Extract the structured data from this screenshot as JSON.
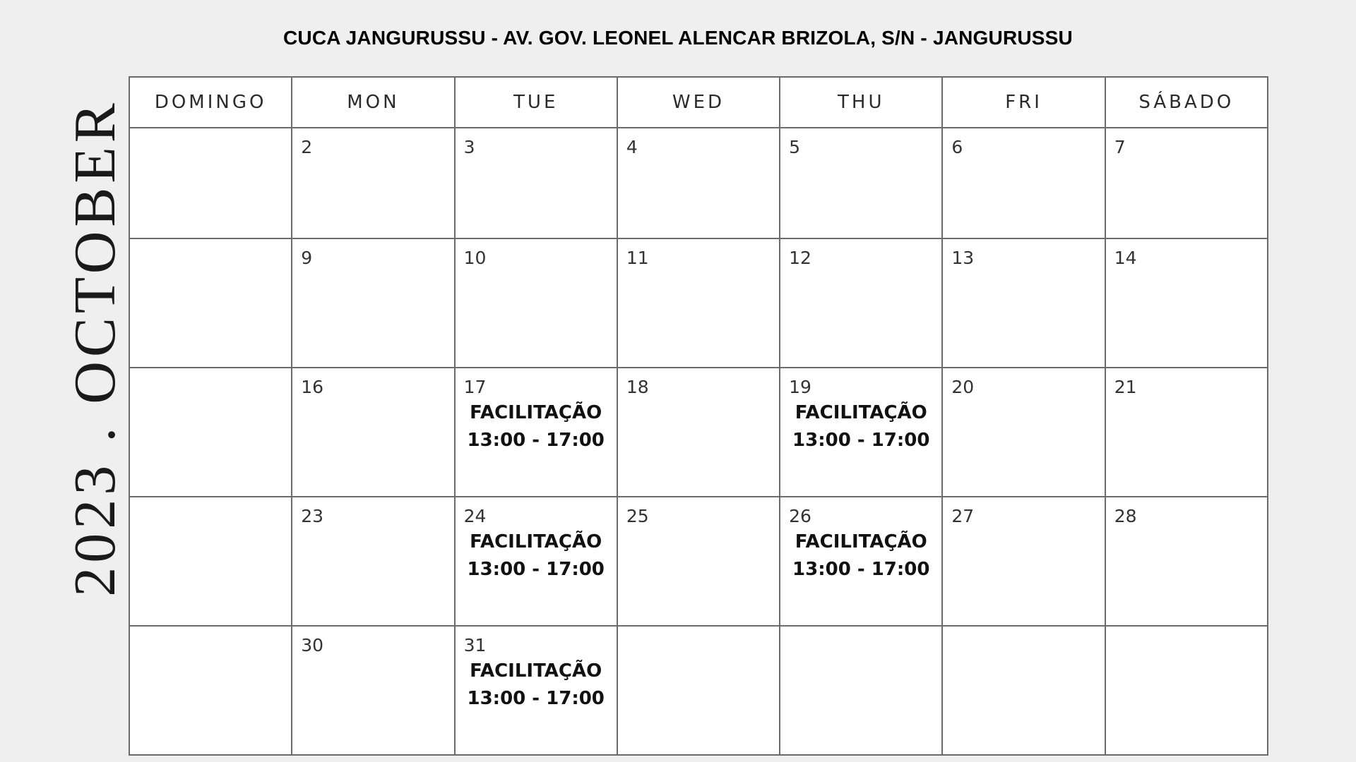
{
  "title": "CUCA JANGURUSSU - AV. GOV. LEONEL ALENCAR BRIZOLA, S/N - JANGURUSSU",
  "side_label": "2023 . OCTOBER",
  "weekdays": [
    "DOMINGO",
    "MON",
    "TUE",
    "WED",
    "THU",
    "FRI",
    "SÁBADO"
  ],
  "weeks": [
    [
      {
        "day": "",
        "event": "",
        "time": ""
      },
      {
        "day": "2",
        "event": "",
        "time": ""
      },
      {
        "day": "3",
        "event": "",
        "time": ""
      },
      {
        "day": "4",
        "event": "",
        "time": ""
      },
      {
        "day": "5",
        "event": "",
        "time": ""
      },
      {
        "day": "6",
        "event": "",
        "time": ""
      },
      {
        "day": "7",
        "event": "",
        "time": ""
      }
    ],
    [
      {
        "day": "",
        "event": "",
        "time": ""
      },
      {
        "day": "9",
        "event": "",
        "time": ""
      },
      {
        "day": "10",
        "event": "",
        "time": ""
      },
      {
        "day": "11",
        "event": "",
        "time": ""
      },
      {
        "day": "12",
        "event": "",
        "time": ""
      },
      {
        "day": "13",
        "event": "",
        "time": ""
      },
      {
        "day": "14",
        "event": "",
        "time": ""
      }
    ],
    [
      {
        "day": "",
        "event": "",
        "time": ""
      },
      {
        "day": "16",
        "event": "",
        "time": ""
      },
      {
        "day": "17",
        "event": "FACILITAÇÃO",
        "time": "13:00 - 17:00"
      },
      {
        "day": "18",
        "event": "",
        "time": ""
      },
      {
        "day": "19",
        "event": "FACILITAÇÃO",
        "time": "13:00 - 17:00"
      },
      {
        "day": "20",
        "event": "",
        "time": ""
      },
      {
        "day": "21",
        "event": "",
        "time": ""
      }
    ],
    [
      {
        "day": "",
        "event": "",
        "time": ""
      },
      {
        "day": "23",
        "event": "",
        "time": ""
      },
      {
        "day": "24",
        "event": "FACILITAÇÃO",
        "time": "13:00 - 17:00"
      },
      {
        "day": "25",
        "event": "",
        "time": ""
      },
      {
        "day": "26",
        "event": "FACILITAÇÃO",
        "time": "13:00 - 17:00"
      },
      {
        "day": "27",
        "event": "",
        "time": ""
      },
      {
        "day": "28",
        "event": "",
        "time": ""
      }
    ],
    [
      {
        "day": "",
        "event": "",
        "time": ""
      },
      {
        "day": "30",
        "event": "",
        "time": ""
      },
      {
        "day": "31",
        "event": "FACILITAÇÃO",
        "time": "13:00 - 17:00"
      },
      {
        "day": "",
        "event": "",
        "time": ""
      },
      {
        "day": "",
        "event": "",
        "time": ""
      },
      {
        "day": "",
        "event": "",
        "time": ""
      },
      {
        "day": "",
        "event": "",
        "time": ""
      }
    ]
  ]
}
